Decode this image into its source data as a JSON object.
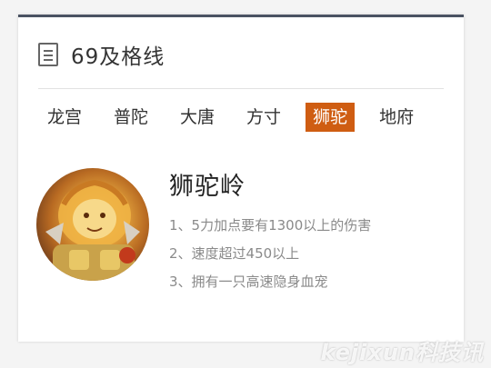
{
  "card": {
    "title": "69及格线",
    "title_icon": "document-icon"
  },
  "tabs": [
    {
      "label": "龙宫",
      "active": false
    },
    {
      "label": "普陀",
      "active": false
    },
    {
      "label": "大唐",
      "active": false
    },
    {
      "label": "方寸",
      "active": false
    },
    {
      "label": "狮驼",
      "active": true
    },
    {
      "label": "地府",
      "active": false
    }
  ],
  "sect": {
    "name": "狮驼岭",
    "tips": [
      "1、5力加点要有1300以上的伤害",
      "2、速度超过450以上",
      "3、拥有一只高速隐身血宠"
    ]
  },
  "watermark": "kejixun科技讯",
  "colors": {
    "accent": "#cf5d12",
    "top_border": "#4a5262",
    "tip_text": "#8a8a8a"
  }
}
